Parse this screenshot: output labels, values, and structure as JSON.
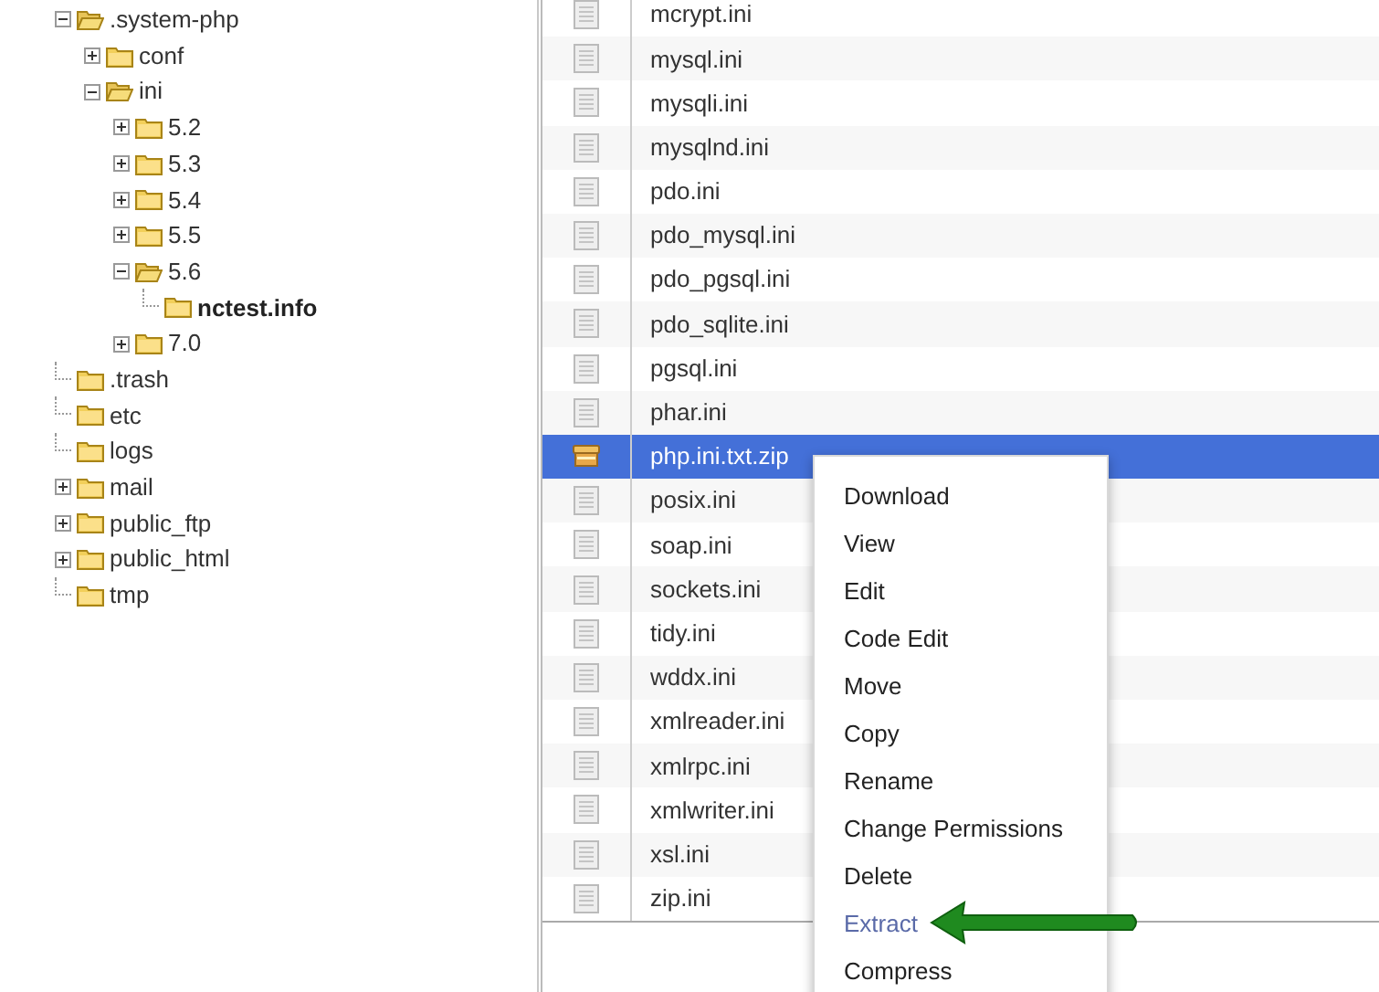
{
  "tree": [
    {
      "label": ".system-php",
      "kind": "branch",
      "expanded": true,
      "selected": false,
      "children": [
        {
          "label": "conf",
          "kind": "branch",
          "expanded": false,
          "selected": false
        },
        {
          "label": "ini",
          "kind": "branch",
          "expanded": true,
          "selected": false,
          "children": [
            {
              "label": "5.2",
              "kind": "branch",
              "expanded": false,
              "selected": false
            },
            {
              "label": "5.3",
              "kind": "branch",
              "expanded": false,
              "selected": false
            },
            {
              "label": "5.4",
              "kind": "branch",
              "expanded": false,
              "selected": false
            },
            {
              "label": "5.5",
              "kind": "branch",
              "expanded": false,
              "selected": false
            },
            {
              "label": "5.6",
              "kind": "branch",
              "expanded": true,
              "selected": false,
              "children": [
                {
                  "label": "nctest.info",
                  "kind": "leaf",
                  "selected": true
                }
              ]
            },
            {
              "label": "7.0",
              "kind": "branch",
              "expanded": false,
              "selected": false
            }
          ]
        }
      ]
    },
    {
      "label": ".trash",
      "kind": "leaf",
      "selected": false
    },
    {
      "label": "etc",
      "kind": "leaf",
      "selected": false
    },
    {
      "label": "logs",
      "kind": "leaf",
      "selected": false
    },
    {
      "label": "mail",
      "kind": "branch",
      "expanded": false,
      "selected": false
    },
    {
      "label": "public_ftp",
      "kind": "branch",
      "expanded": false,
      "selected": false
    },
    {
      "label": "public_html",
      "kind": "branch",
      "expanded": false,
      "selected": false
    },
    {
      "label": "tmp",
      "kind": "leaf",
      "selected": false
    }
  ],
  "files": [
    {
      "name": "mcrypt.ini",
      "kind": "text",
      "selected": false
    },
    {
      "name": "mysql.ini",
      "kind": "text",
      "selected": false
    },
    {
      "name": "mysqli.ini",
      "kind": "text",
      "selected": false
    },
    {
      "name": "mysqlnd.ini",
      "kind": "text",
      "selected": false
    },
    {
      "name": "pdo.ini",
      "kind": "text",
      "selected": false
    },
    {
      "name": "pdo_mysql.ini",
      "kind": "text",
      "selected": false
    },
    {
      "name": "pdo_pgsql.ini",
      "kind": "text",
      "selected": false
    },
    {
      "name": "pdo_sqlite.ini",
      "kind": "text",
      "selected": false
    },
    {
      "name": "pgsql.ini",
      "kind": "text",
      "selected": false
    },
    {
      "name": "phar.ini",
      "kind": "text",
      "selected": false
    },
    {
      "name": "php.ini.txt.zip",
      "kind": "archive",
      "selected": true
    },
    {
      "name": "posix.ini",
      "kind": "text",
      "selected": false
    },
    {
      "name": "soap.ini",
      "kind": "text",
      "selected": false
    },
    {
      "name": "sockets.ini",
      "kind": "text",
      "selected": false
    },
    {
      "name": "tidy.ini",
      "kind": "text",
      "selected": false
    },
    {
      "name": "wddx.ini",
      "kind": "text",
      "selected": false
    },
    {
      "name": "xmlreader.ini",
      "kind": "text",
      "selected": false
    },
    {
      "name": "xmlrpc.ini",
      "kind": "text",
      "selected": false
    },
    {
      "name": "xmlwriter.ini",
      "kind": "text",
      "selected": false
    },
    {
      "name": "xsl.ini",
      "kind": "text",
      "selected": false
    },
    {
      "name": "zip.ini",
      "kind": "text",
      "selected": false
    }
  ],
  "context_menu": {
    "items": [
      {
        "label": "Download",
        "hovered": false
      },
      {
        "label": "View",
        "hovered": false
      },
      {
        "label": "Edit",
        "hovered": false
      },
      {
        "label": "Code Edit",
        "hovered": false
      },
      {
        "label": "Move",
        "hovered": false
      },
      {
        "label": "Copy",
        "hovered": false
      },
      {
        "label": "Rename",
        "hovered": false
      },
      {
        "label": "Change Permissions",
        "hovered": false
      },
      {
        "label": "Delete",
        "hovered": false
      },
      {
        "label": "Extract",
        "hovered": true
      },
      {
        "label": "Compress",
        "hovered": false
      }
    ]
  }
}
